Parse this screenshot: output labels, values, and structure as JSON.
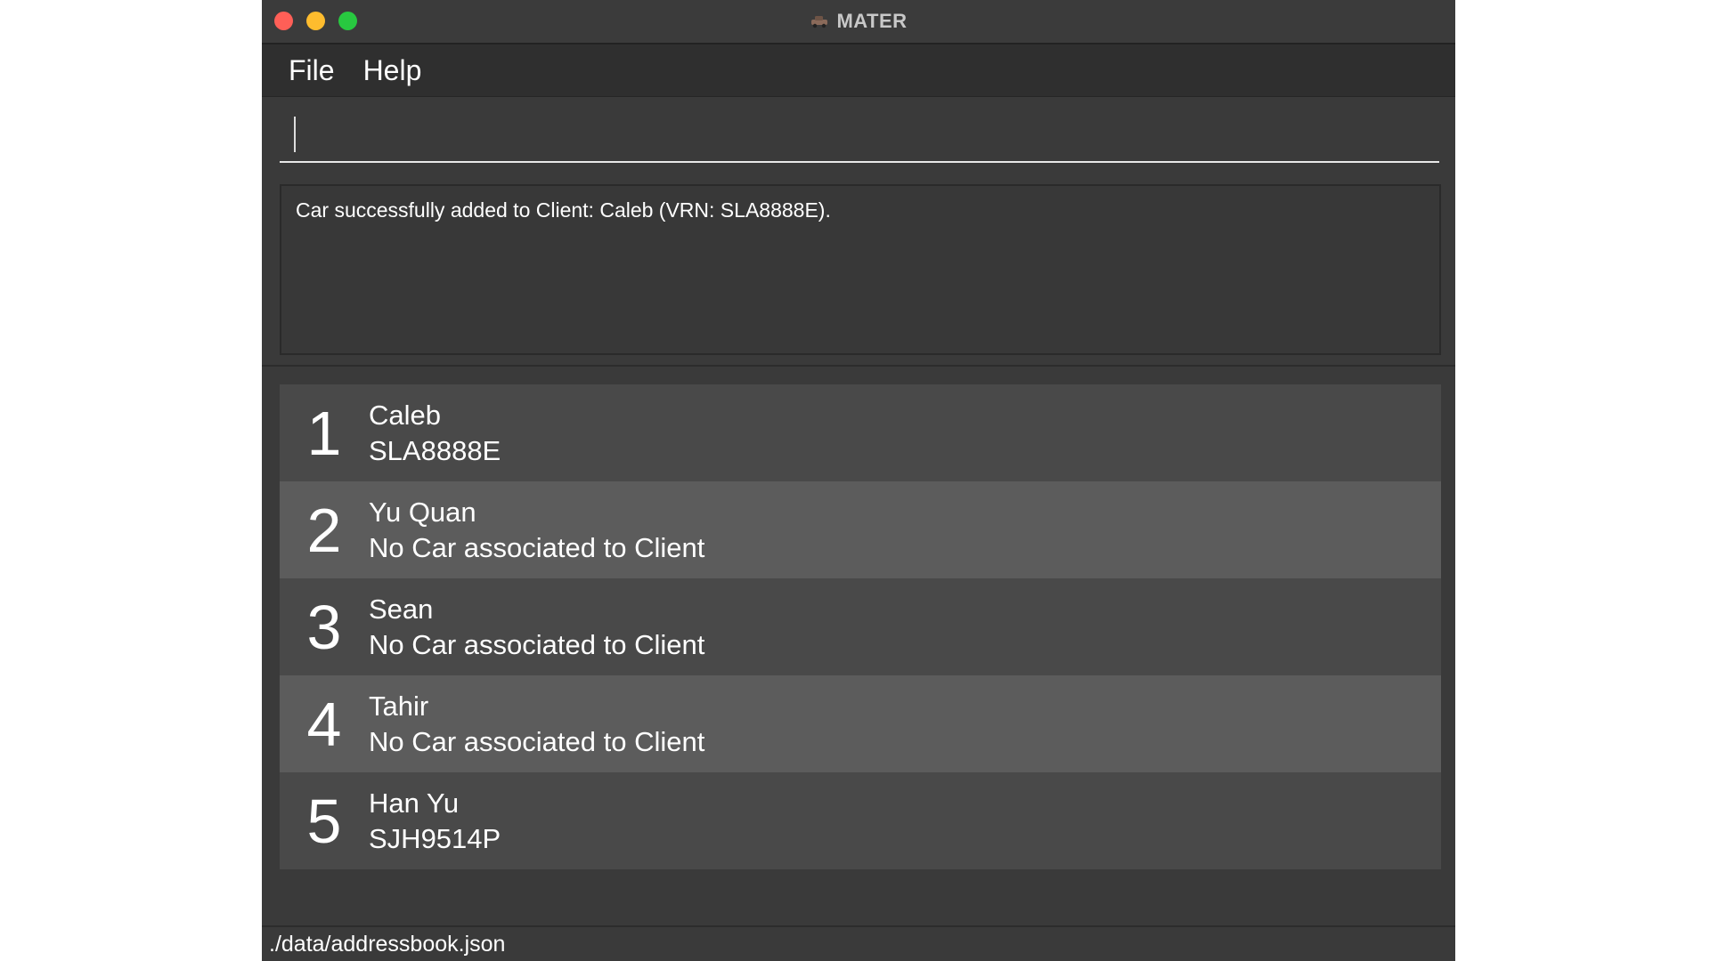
{
  "window": {
    "title": "MATER",
    "icon": "car-icon"
  },
  "menubar": {
    "items": [
      {
        "label": "File"
      },
      {
        "label": "Help"
      }
    ]
  },
  "command": {
    "value": "",
    "placeholder": ""
  },
  "result": {
    "message": "Car successfully added to Client: Caleb (VRN: SLA8888E)."
  },
  "clients": [
    {
      "index": "1",
      "name": "Caleb",
      "car": "SLA8888E"
    },
    {
      "index": "2",
      "name": "Yu Quan",
      "car": "No Car associated to Client"
    },
    {
      "index": "3",
      "name": "Sean",
      "car": "No Car associated to Client"
    },
    {
      "index": "4",
      "name": "Tahir",
      "car": "No Car associated to Client"
    },
    {
      "index": "5",
      "name": "Han Yu",
      "car": "SJH9514P"
    }
  ],
  "status": {
    "path": "./data/addressbook.json"
  },
  "colors": {
    "background": "#3a3a3a",
    "card_odd": "#494949",
    "card_even": "#5c5c5c",
    "close": "#ff5f57",
    "minimize": "#febc2e",
    "maximize": "#28c840"
  }
}
